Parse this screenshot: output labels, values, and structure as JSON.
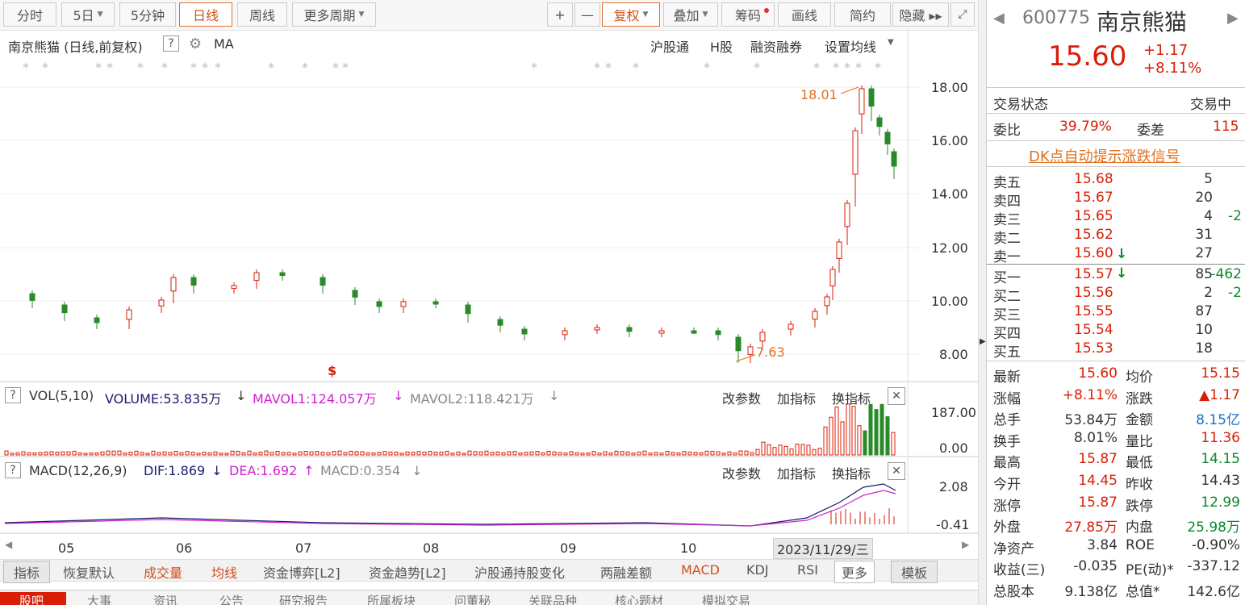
{
  "toolbar": {
    "tabs": [
      "分时",
      "5日",
      "5分钟",
      "日线",
      "周线",
      "更多周期"
    ],
    "zoom_in": "+",
    "zoom_out": "—",
    "fuquan": "复权",
    "diejia": "叠加",
    "chouma": "筹码",
    "huaxian": "画线",
    "jianyue": "简约",
    "yincang": "隐藏 ▸▸"
  },
  "chart": {
    "title": "南京熊猫 (日线,前复权)",
    "help": "?",
    "ma_label": "MA",
    "links": [
      "沪股通",
      "H股",
      "融资融券",
      "设置均线"
    ],
    "price_labels": [
      "18.00",
      "16.00",
      "14.00",
      "12.00",
      "10.00",
      "8.00"
    ],
    "high_mark": "18.01",
    "low_mark": "7.63",
    "s_mark": "$",
    "vol": {
      "title": "VOL(5,10)",
      "volume": "VOLUME:53.835万",
      "mavol1": "MAVOL1:124.057万",
      "mavol2": "MAVOL2:118.421万",
      "axis": [
        "187.00",
        "0.00"
      ]
    },
    "macd": {
      "title": "MACD(12,26,9)",
      "dif": "DIF:1.869",
      "dea": "DEA:1.692",
      "macd": "MACD:0.354",
      "axis": [
        "2.08",
        "-0.41"
      ]
    },
    "panel_buttons": [
      "改参数",
      "加指标",
      "换指标"
    ],
    "months": [
      "05",
      "06",
      "07",
      "08",
      "09",
      "10"
    ],
    "date_label": "2023/11/29/三",
    "colors": {
      "up": "#d81e06",
      "down": "#2a8a2a",
      "mavol1": "#d020d0",
      "mavol2": "#888888",
      "dif": "#1a1a6a",
      "dea": "#d020d0"
    }
  },
  "indicator_tabs": [
    "指标",
    "恢复默认",
    "成交量",
    "均线",
    "资金博弈[L2]",
    "资金趋势[L2]",
    "沪股通持股变化",
    "两融差额",
    "MACD",
    "KDJ",
    "RSI",
    "更多",
    "模板"
  ],
  "bottom_tabs": [
    "股吧",
    "大事",
    "资讯",
    "公告",
    "研究报告",
    "所属板块",
    "问董秘",
    "关联品种",
    "核心题材",
    "模拟交易"
  ],
  "quote": {
    "code": "600775",
    "name": "南京熊猫",
    "price": "15.60",
    "change": "+1.17",
    "pct": "+8.11%",
    "status_label": "交易状态",
    "status": "交易中",
    "weibi_label": "委比",
    "weibi": "39.79%",
    "weicha_label": "委差",
    "weicha": "115",
    "dk_link": "DK点自动提示涨跌信号",
    "asks": [
      {
        "label": "卖五",
        "price": "15.68",
        "vol": "5",
        "chg": ""
      },
      {
        "label": "卖四",
        "price": "15.67",
        "vol": "20",
        "chg": ""
      },
      {
        "label": "卖三",
        "price": "15.65",
        "vol": "4",
        "chg": "-2"
      },
      {
        "label": "卖二",
        "price": "15.62",
        "vol": "31",
        "chg": ""
      },
      {
        "label": "卖一",
        "price": "15.60",
        "vol": "27",
        "chg": ""
      }
    ],
    "bids": [
      {
        "label": "买一",
        "price": "15.57",
        "vol": "85",
        "chg": "-462"
      },
      {
        "label": "买二",
        "price": "15.56",
        "vol": "2",
        "chg": "-2"
      },
      {
        "label": "买三",
        "price": "15.55",
        "vol": "87",
        "chg": ""
      },
      {
        "label": "买四",
        "price": "15.54",
        "vol": "10",
        "chg": ""
      },
      {
        "label": "买五",
        "price": "15.53",
        "vol": "18",
        "chg": ""
      }
    ],
    "stats": [
      {
        "l1": "最新",
        "v1": "15.60",
        "c1": "red",
        "l2": "均价",
        "v2": "15.15",
        "c2": "red"
      },
      {
        "l1": "涨幅",
        "v1": "+8.11%",
        "c1": "red",
        "l2": "涨跌",
        "v2": "▲1.17",
        "c2": "red"
      },
      {
        "l1": "总手",
        "v1": "53.84万",
        "c1": "",
        "l2": "金额",
        "v2": "8.15亿",
        "c2": "blue"
      },
      {
        "l1": "换手",
        "v1": "8.01%",
        "c1": "",
        "l2": "量比",
        "v2": "11.36",
        "c2": "red"
      },
      {
        "l1": "最高",
        "v1": "15.87",
        "c1": "red",
        "l2": "最低",
        "v2": "14.15",
        "c2": "green"
      },
      {
        "l1": "今开",
        "v1": "14.45",
        "c1": "red",
        "l2": "昨收",
        "v2": "14.43",
        "c2": ""
      },
      {
        "l1": "涨停",
        "v1": "15.87",
        "c1": "red",
        "l2": "跌停",
        "v2": "12.99",
        "c2": "green"
      },
      {
        "l1": "外盘",
        "v1": "27.85万",
        "c1": "red",
        "l2": "内盘",
        "v2": "25.98万",
        "c2": "green"
      },
      {
        "l1": "净资产",
        "v1": "3.84",
        "c1": "",
        "l2": "ROE",
        "v2": "-0.90%",
        "c2": ""
      },
      {
        "l1": "收益(三)",
        "v1": "-0.035",
        "c1": "",
        "l2": "PE(动)*",
        "v2": "-337.12",
        "c2": ""
      },
      {
        "l1": "总股本",
        "v1": "9.138亿",
        "c1": "",
        "l2": "总值*",
        "v2": "142.6亿",
        "c2": ""
      }
    ]
  }
}
